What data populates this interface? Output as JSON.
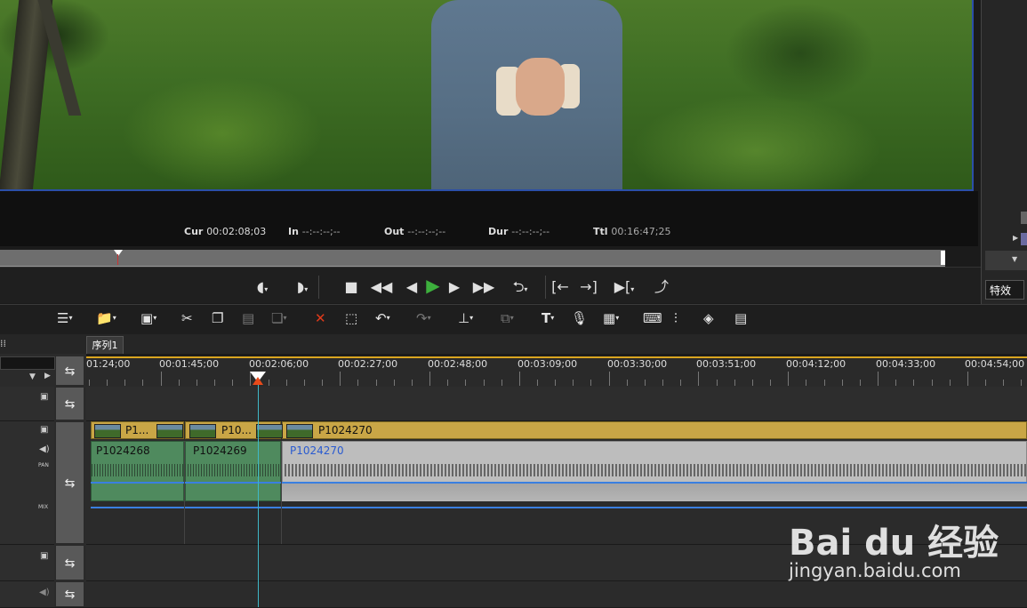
{
  "timecode": {
    "cur_label": "Cur",
    "cur_value": "00:02:08;03",
    "in_label": "In",
    "in_value": "--:--:--;--",
    "out_label": "Out",
    "out_value": "--:--:--;--",
    "dur_label": "Dur",
    "dur_value": "--:--:--;--",
    "ttl_label": "Ttl",
    "ttl_value": "00:16:47;25"
  },
  "right_panel": {
    "tab_label": "特效"
  },
  "sequence_tab": "序列1",
  "ruler_labels": [
    "01:24;00",
    "00:01:45;00",
    "00:02:06;00",
    "00:02:27;00",
    "00:02:48;00",
    "00:03:09;00",
    "00:03:30;00",
    "00:03:51;00",
    "00:04:12;00",
    "00:04:33;00",
    "00:04:54;00"
  ],
  "track_labels": {
    "pan": "PAN",
    "mix": "MIX"
  },
  "clips": {
    "video": [
      "P1...",
      "P10...",
      "P1024270"
    ],
    "audio": [
      "P1024268",
      "P1024269",
      "P1024270"
    ]
  },
  "watermark": {
    "logo": "Bai du 经验",
    "url": "jingyan.baidu.com"
  },
  "colors": {
    "accent": "#d9a520",
    "playhead": "#3fb8c8",
    "video_clip": "#c9a646",
    "audio_clip_selected": "#4f8a5e",
    "audio_clip": "#bdbdbd",
    "play_icon": "#3db03d"
  }
}
